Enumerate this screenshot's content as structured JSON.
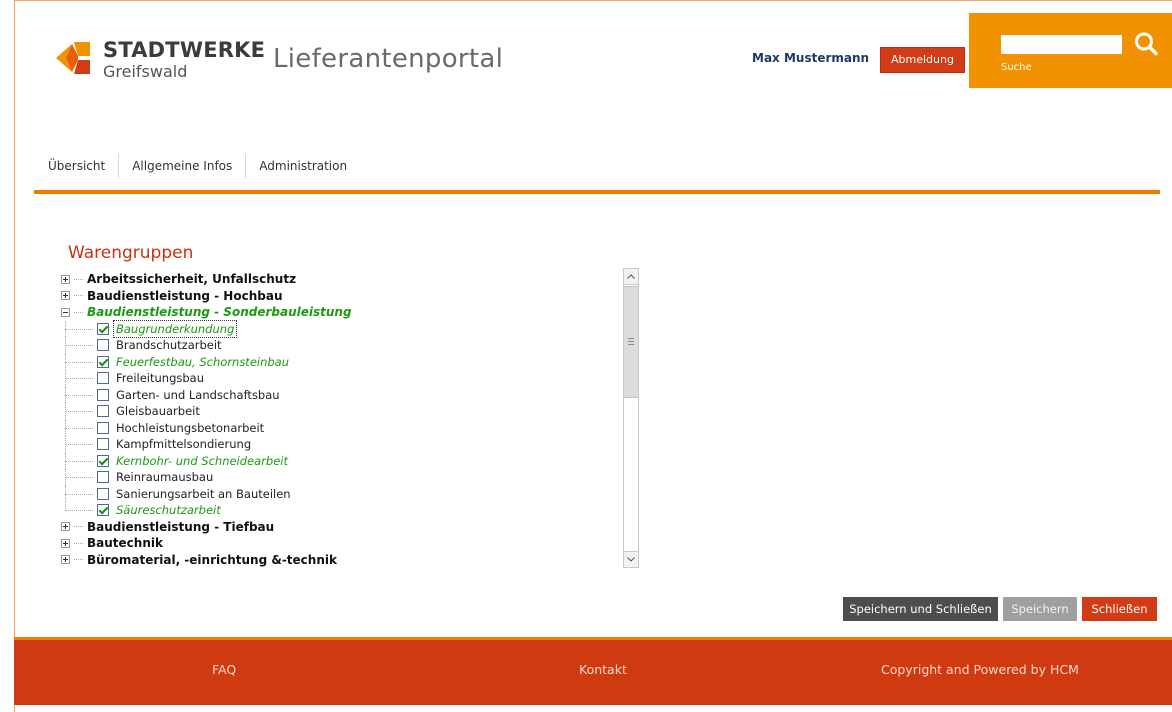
{
  "header": {
    "brand_name": "STADTWERKE",
    "brand_sub": "Greifswald",
    "portal_title": "Lieferantenportal",
    "user_name": "Max Mustermann",
    "logout_label": "Abmeldung",
    "search": {
      "value": "",
      "placeholder": "",
      "label": "Suche"
    },
    "colors": {
      "brand_orange": "#f39200",
      "brand_red": "#d13b16"
    }
  },
  "nav": {
    "items": [
      {
        "label": "Übersicht"
      },
      {
        "label": "Allgemeine Infos"
      },
      {
        "label": "Administration"
      }
    ]
  },
  "section": {
    "title": "Warengruppen"
  },
  "tree": {
    "groups": [
      {
        "label": "Arbeitssicherheit, Unfallschutz",
        "expanded": false
      },
      {
        "label": "Baudienstleistung - Hochbau",
        "expanded": false
      },
      {
        "label": "Baudienstleistung - Sonderbauleistung",
        "expanded": true,
        "children": [
          {
            "label": "Baugrunderkundung",
            "checked": true,
            "focused": true
          },
          {
            "label": "Brandschutzarbeit",
            "checked": false
          },
          {
            "label": "Feuerfestbau, Schornsteinbau",
            "checked": true
          },
          {
            "label": "Freileitungsbau",
            "checked": false
          },
          {
            "label": "Garten- und Landschaftsbau",
            "checked": false
          },
          {
            "label": "Gleisbauarbeit",
            "checked": false
          },
          {
            "label": "Hochleistungsbetonarbeit",
            "checked": false
          },
          {
            "label": "Kampfmittelsondierung",
            "checked": false
          },
          {
            "label": "Kernbohr- und Schneidearbeit",
            "checked": true
          },
          {
            "label": "Reinraumausbau",
            "checked": false
          },
          {
            "label": "Sanierungsarbeit an Bauteilen",
            "checked": false
          },
          {
            "label": "Säureschutzarbeit",
            "checked": true
          }
        ]
      },
      {
        "label": "Baudienstleistung - Tiefbau",
        "expanded": false
      },
      {
        "label": "Bautechnik",
        "expanded": false
      },
      {
        "label": "Büromaterial, -einrichtung &-technik",
        "expanded": false
      }
    ]
  },
  "actions": {
    "save_close_label": "Speichern und Schließen",
    "save_label": "Speichern",
    "close_label": "Schließen"
  },
  "footer": {
    "faq_label": "FAQ",
    "contact_label": "Kontakt",
    "copyright_label": "Copyright and Powered by HCM"
  }
}
